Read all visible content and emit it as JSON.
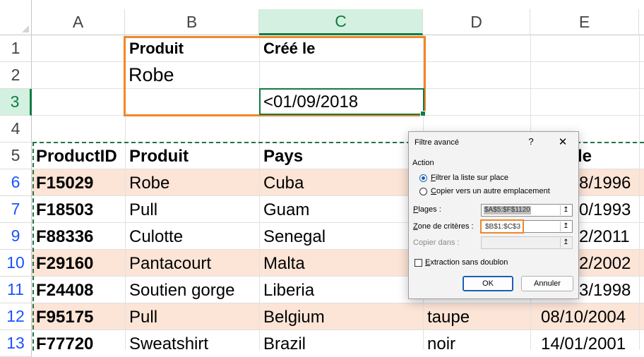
{
  "columns": [
    "A",
    "B",
    "C",
    "D",
    "E"
  ],
  "rows": [
    "1",
    "2",
    "3",
    "4",
    "5",
    "6",
    "7",
    "9",
    "10",
    "11",
    "12",
    "13"
  ],
  "criteria": {
    "b1": "Produit",
    "c1": "Créé le",
    "b2": "Robe",
    "c3": "<01/09/2018"
  },
  "table_headers": {
    "a": "ProductID",
    "b": "Produit",
    "c": "Pays",
    "e_partial": "le"
  },
  "table_rows": [
    {
      "id": "F15029",
      "produit": "Robe",
      "pays": "Cuba",
      "color": "",
      "date": "8/1996"
    },
    {
      "id": "F18503",
      "produit": "Pull",
      "pays": "Guam",
      "color": "",
      "date": "0/1993"
    },
    {
      "id": "F88336",
      "produit": "Culotte",
      "pays": "Senegal",
      "color": "",
      "date": "2/2011"
    },
    {
      "id": "F29160",
      "produit": "Pantacourt",
      "pays": "Malta",
      "color": "",
      "date": "2/2002"
    },
    {
      "id": "F24408",
      "produit": "Soutien gorge",
      "pays": "Liberia",
      "color": "",
      "date": "3/1998"
    },
    {
      "id": "F95175",
      "produit": "Pull",
      "pays": "Belgium",
      "color": "taupe",
      "date": "08/10/2004"
    },
    {
      "id": "F77720",
      "produit": "Sweatshirt",
      "pays": "Brazil",
      "color": "noir",
      "date": "14/01/2001"
    }
  ],
  "dialog": {
    "title": "Filtre avancé",
    "help": "?",
    "close": "✕",
    "section_label": "Action",
    "option1_key": "F",
    "option1_rest": "iltrer la liste sur place",
    "option2_key": "C",
    "option2_rest": "opier vers un autre emplacement",
    "plages_key": "P",
    "plages_rest": "lages :",
    "plages_value": "$A$5:$F$1120",
    "zone_key": "Z",
    "zone_rest": "one de critères :",
    "zone_value": "$B$1:$C$3",
    "copier_label": "Copier dans :",
    "copier_value": "",
    "extraction_key": "E",
    "extraction_rest": "xtraction sans doublon",
    "ok": "OK",
    "cancel": "Annuler",
    "collapse_glyph": "↥"
  },
  "colors": {
    "accent_green": "#107c41",
    "highlight_orange": "#f0862a",
    "band_fill": "#fce4d6"
  }
}
